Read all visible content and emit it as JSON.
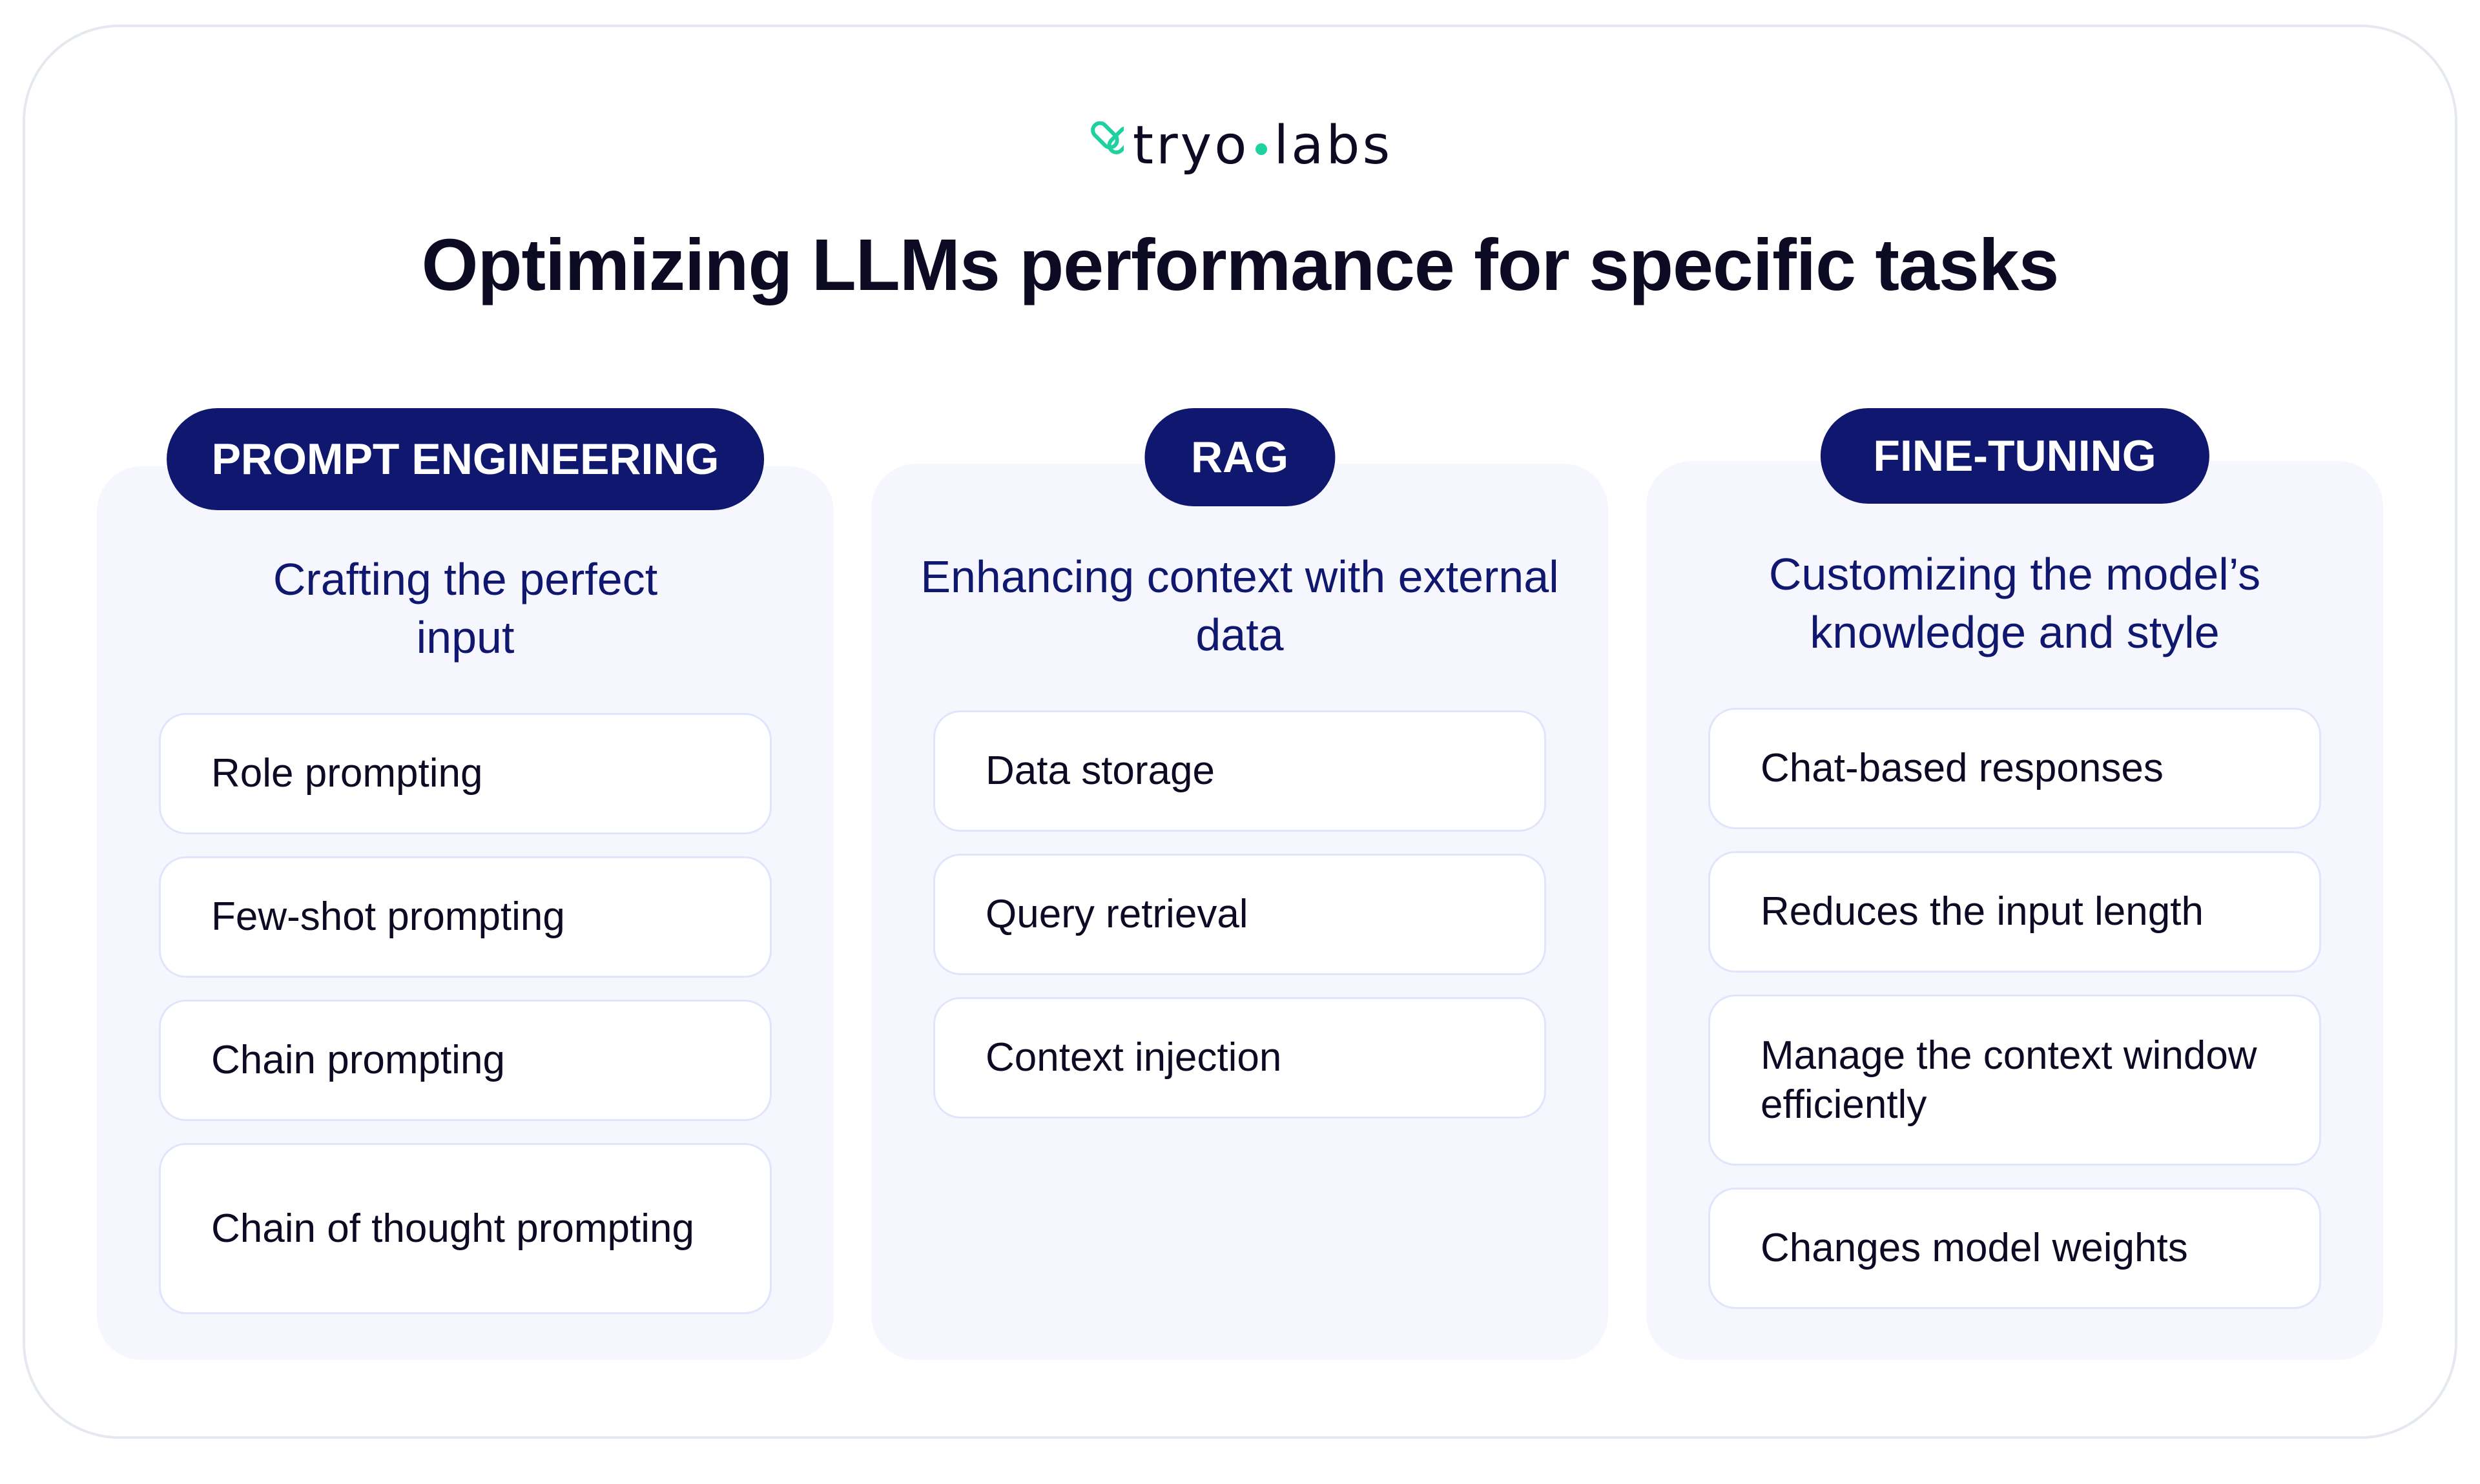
{
  "logo": {
    "icon": "tryolabs-chevron-icon",
    "brand_left": "tryo",
    "brand_right": "labs",
    "accent_color": "#1fd1a0"
  },
  "title": "Optimizing LLMs performance for specific tasks",
  "colors": {
    "title_text": "#0d0b24",
    "pill_bg": "#10176e",
    "pill_text": "#ffffff",
    "subtitle_text": "#10176e",
    "card_bg": "#f5f6fe",
    "item_bg": "#ffffff",
    "item_border": "#e1e5fb",
    "frame_border": "#e4e9f0"
  },
  "columns": [
    {
      "label": "PROMPT ENGINEERING",
      "subtitle": "Crafting the perfect input",
      "items": [
        "Role prompting",
        "Few-shot prompting",
        "Chain prompting",
        "Chain of thought prompting"
      ]
    },
    {
      "label": "RAG",
      "subtitle": "Enhancing context with external data",
      "items": [
        "Data storage",
        "Query retrieval",
        "Context injection"
      ]
    },
    {
      "label": "FINE-TUNING",
      "subtitle": "Customizing the model’s knowledge and style",
      "items": [
        "Chat-based responses",
        "Reduces the input length",
        "Manage the context window efficiently",
        "Changes model weights"
      ]
    }
  ]
}
